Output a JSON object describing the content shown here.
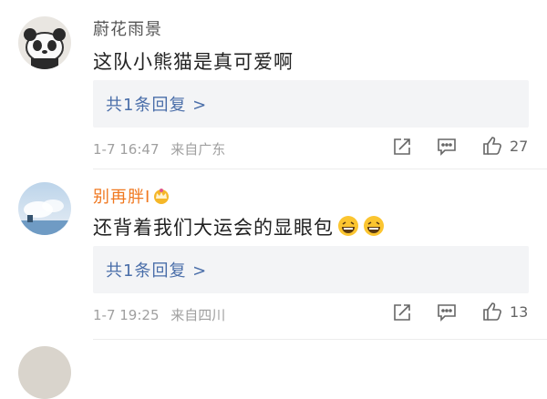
{
  "comments": [
    {
      "username": "蔚花雨景",
      "text": "这队小熊猫是真可爱啊",
      "reply_label": "共1条回复 >",
      "date": "1-7 16:47",
      "location": "来自广东",
      "likes": "27"
    },
    {
      "username": "别再胖I",
      "text": "还背着我们大运会的显眼包",
      "reply_label": "共1条回复 >",
      "date": "1-7 19:25",
      "location": "来自四川",
      "likes": "13"
    }
  ],
  "colors": {
    "link": "#4a6ea9",
    "vip_name": "#f07820",
    "meta": "#a0a0a0"
  },
  "icons": [
    "share-icon",
    "comment-icon",
    "like-icon",
    "crown-icon",
    "laughing-emoji-icon"
  ]
}
